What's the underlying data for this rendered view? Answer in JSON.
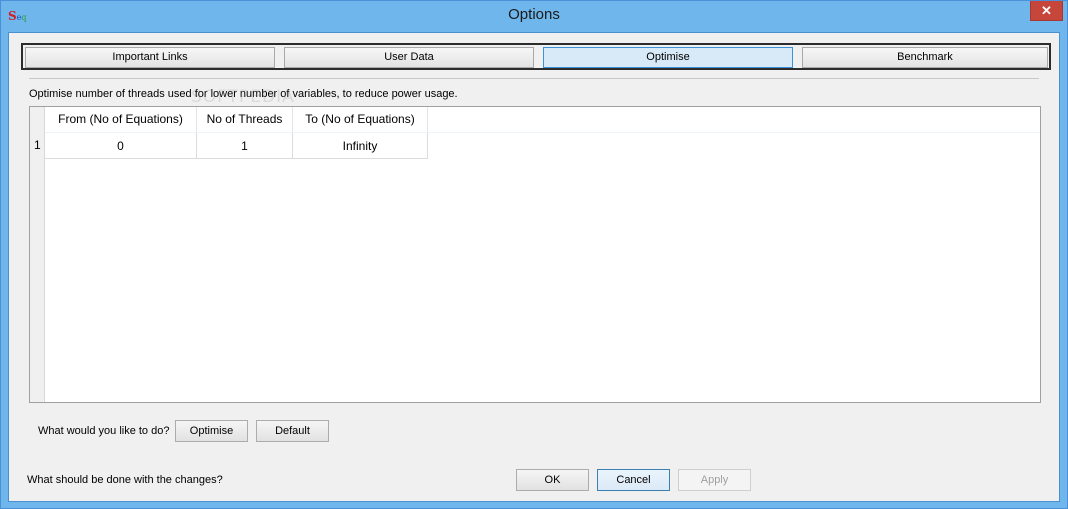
{
  "window": {
    "title": "Options",
    "close_glyph": "✕",
    "icon_letters": [
      "S",
      "e",
      "q"
    ]
  },
  "tabs": [
    {
      "label": "Important Links",
      "active": false
    },
    {
      "label": "User Data",
      "active": false
    },
    {
      "label": "Optimise",
      "active": true
    },
    {
      "label": "Benchmark",
      "active": false
    }
  ],
  "optimise": {
    "description": "Optimise number of threads used for lower number of variables, to reduce power usage.",
    "table": {
      "columns": [
        "From (No of Equations)",
        "No of Threads",
        "To (No of Equations)"
      ],
      "rows": [
        {
          "index": "1",
          "cells": [
            "0",
            "1",
            "Infinity"
          ]
        }
      ]
    },
    "question": "What would you like to do?",
    "optimise_button": "Optimise",
    "default_button": "Default"
  },
  "footer": {
    "question": "What should be done with the changes?",
    "ok_button": "OK",
    "cancel_button": "Cancel",
    "apply_button": "Apply"
  },
  "watermark": "SOFTPEDIA",
  "colors": {
    "titlebar": "#6fb6ec",
    "active_tab": "#d8eaf8",
    "close_button": "#c7463b"
  }
}
